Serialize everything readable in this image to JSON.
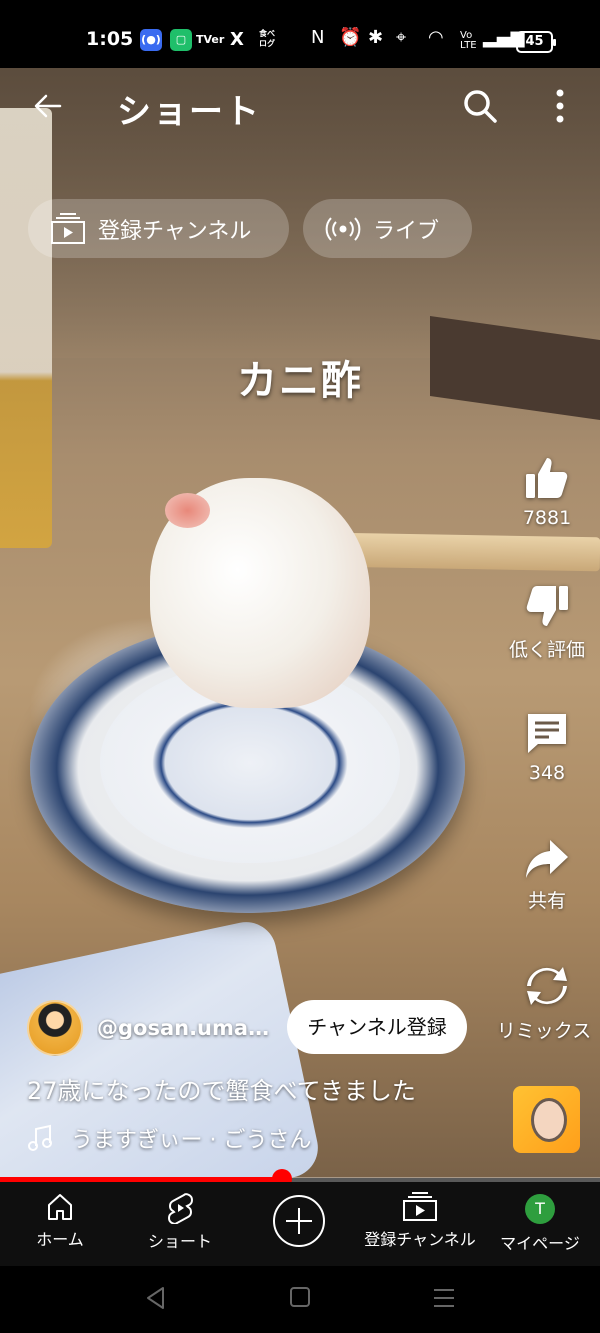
{
  "status_bar": {
    "time": "1:05",
    "apps": [
      "(●)",
      "▢",
      "TVer",
      "X",
      "食べログ"
    ],
    "battery": "45"
  },
  "header": {
    "title": "ショート"
  },
  "chips": {
    "subscriptions": "登録チャンネル",
    "live": "ライブ"
  },
  "video": {
    "overlay_text": "カニ酢",
    "progress_fraction": 0.47
  },
  "actions": {
    "like_count": "7881",
    "dislike_label": "低く評価",
    "comment_count": "348",
    "share_label": "共有",
    "remix_label": "リミックス"
  },
  "channel": {
    "handle": "@gosan.umasugi",
    "subscribe_label": "チャンネル登録"
  },
  "description": "27歳になったので蟹食べてきました",
  "music": "うますぎぃー · ごうさん",
  "bottom_nav": {
    "home": "ホーム",
    "shorts": "ショート",
    "subscriptions": "登録チャンネル",
    "mypage": "マイページ",
    "avatar_letter": "T"
  },
  "colors": {
    "accent": "#ff0000",
    "nav_bg": "#0f0f0f",
    "avatar_green": "#2e9e3e"
  }
}
